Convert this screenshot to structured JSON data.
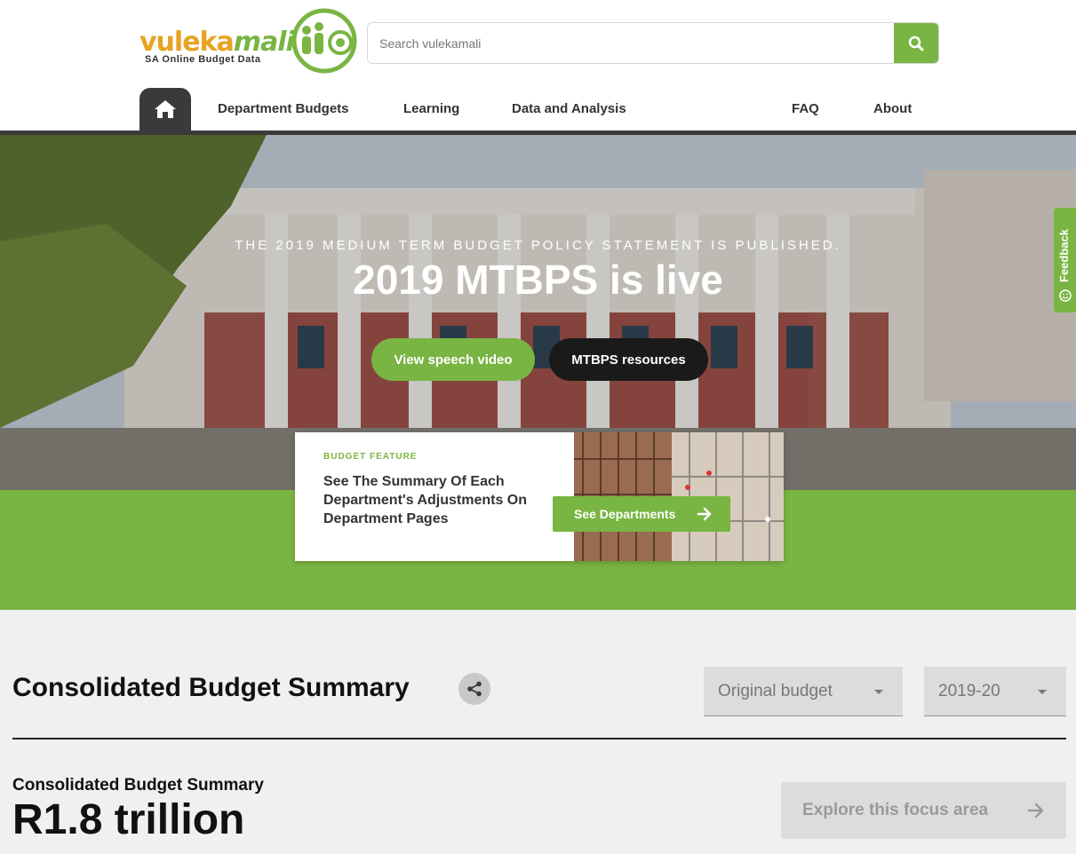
{
  "brand": {
    "logo_word_a": "vuleka",
    "logo_word_b": "mali",
    "tagline": "SA Online Budget Data",
    "green": "#79b543",
    "orange": "#e8a321"
  },
  "search": {
    "placeholder": "Search vulekamali",
    "icon": "search-icon"
  },
  "nav": {
    "home_icon": "home-icon",
    "items": [
      "Department Budgets",
      "Learning",
      "Data and Analysis",
      "FAQ",
      "About"
    ]
  },
  "hero": {
    "kicker": "THE 2019 MEDIUM TERM BUDGET POLICY STATEMENT IS PUBLISHED.",
    "title": "2019 MTBPS is live",
    "button_primary": "View speech video",
    "button_secondary": "MTBPS resources"
  },
  "feature": {
    "kicker": "BUDGET FEATURE",
    "title": "See The Summary Of Each Department's Adjustments On Department Pages",
    "button": "See Departments"
  },
  "feedback": {
    "label": "Feedback",
    "icon": "smiley-icon"
  },
  "summary": {
    "title": "Consolidated Budget Summary",
    "share_icon": "share-icon",
    "budget_type": "Original budget",
    "year": "2019-20",
    "sub_label": "Consolidated Budget Summary",
    "value": "R1.8 trillion",
    "explore": "Explore this focus area"
  }
}
